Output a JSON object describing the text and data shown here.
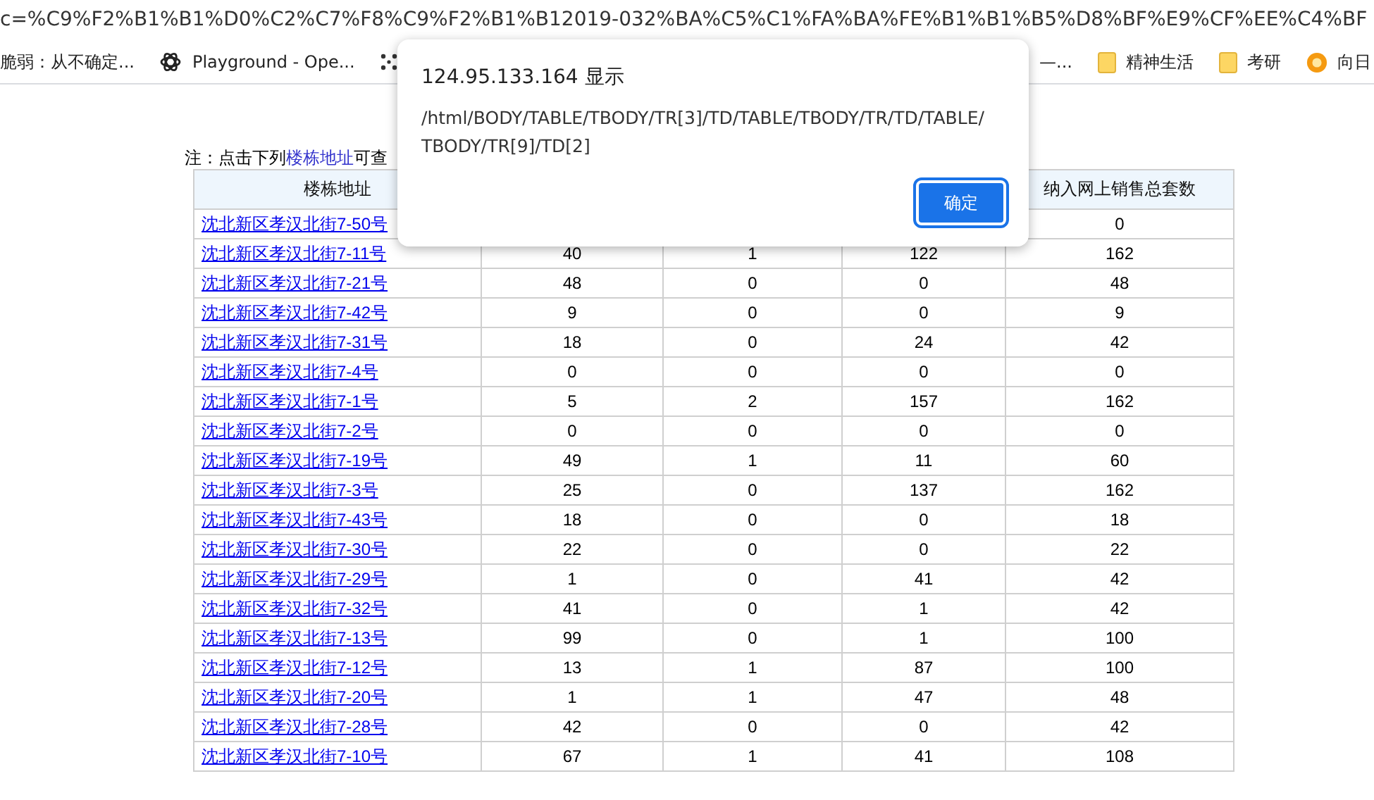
{
  "address_bar": {
    "url": "c=%C9%F2%B1%B1%D0%C2%C7%F8%C9%F2%B1%B12019-032%BA%C5%C1%FA%BA%FE%B1%B1%B5%D8%BF%E9%CF%EE%C4%BF"
  },
  "bookmarks": [
    {
      "label": "脆弱：从不确定..."
    },
    {
      "label": "Playground - Ope..."
    },
    {
      "label": "—..."
    },
    {
      "label": "精神生活"
    },
    {
      "label": "考研"
    },
    {
      "label": "向日"
    }
  ],
  "note": {
    "prefix": "注：点击下列",
    "link": "楼栋地址",
    "suffix": "可查"
  },
  "table": {
    "columns": [
      "楼栋地址",
      null,
      null,
      null,
      "纳入网上销售总套数"
    ],
    "rows": [
      {
        "address": "沈北新区孝汉北街7-50号",
        "cells": [
          null,
          null,
          null,
          "0"
        ]
      },
      {
        "address": "沈北新区孝汉北街7-11号",
        "cells": [
          "40",
          "1",
          "122",
          "162"
        ]
      },
      {
        "address": "沈北新区孝汉北街7-21号",
        "cells": [
          "48",
          "0",
          "0",
          "48"
        ]
      },
      {
        "address": "沈北新区孝汉北街7-42号",
        "cells": [
          "9",
          "0",
          "0",
          "9"
        ]
      },
      {
        "address": "沈北新区孝汉北街7-31号",
        "cells": [
          "18",
          "0",
          "24",
          "42"
        ]
      },
      {
        "address": "沈北新区孝汉北街7-4号",
        "cells": [
          "0",
          "0",
          "0",
          "0"
        ]
      },
      {
        "address": "沈北新区孝汉北街7-1号",
        "cells": [
          "5",
          "2",
          "157",
          "162"
        ]
      },
      {
        "address": "沈北新区孝汉北街7-2号",
        "cells": [
          "0",
          "0",
          "0",
          "0"
        ]
      },
      {
        "address": "沈北新区孝汉北街7-19号",
        "cells": [
          "49",
          "1",
          "11",
          "60"
        ]
      },
      {
        "address": "沈北新区孝汉北街7-3号",
        "cells": [
          "25",
          "0",
          "137",
          "162"
        ]
      },
      {
        "address": "沈北新区孝汉北街7-43号",
        "cells": [
          "18",
          "0",
          "0",
          "18"
        ]
      },
      {
        "address": "沈北新区孝汉北街7-30号",
        "cells": [
          "22",
          "0",
          "0",
          "22"
        ]
      },
      {
        "address": "沈北新区孝汉北街7-29号",
        "cells": [
          "1",
          "0",
          "41",
          "42"
        ]
      },
      {
        "address": "沈北新区孝汉北街7-32号",
        "cells": [
          "41",
          "0",
          "1",
          "42"
        ]
      },
      {
        "address": "沈北新区孝汉北街7-13号",
        "cells": [
          "99",
          "0",
          "1",
          "100"
        ]
      },
      {
        "address": "沈北新区孝汉北街7-12号",
        "cells": [
          "13",
          "1",
          "87",
          "100"
        ]
      },
      {
        "address": "沈北新区孝汉北街7-20号",
        "cells": [
          "1",
          "1",
          "47",
          "48"
        ]
      },
      {
        "address": "沈北新区孝汉北街7-28号",
        "cells": [
          "42",
          "0",
          "0",
          "42"
        ]
      },
      {
        "address": "沈北新区孝汉北街7-10号",
        "cells": [
          "67",
          "1",
          "41",
          "108"
        ]
      }
    ]
  },
  "dialog": {
    "title": "124.95.133.164 显示",
    "message": "/html/BODY/TABLE/TBODY/TR[3]/TD/TABLE/TBODY/TR/TD/TABLE/ TBODY/TR[9]/TD[2]",
    "button": "确定"
  }
}
